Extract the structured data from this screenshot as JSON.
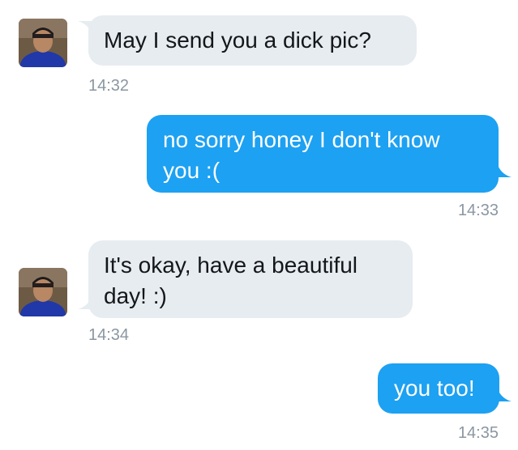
{
  "colors": {
    "incoming_bubble": "#e6ecf0",
    "outgoing_bubble": "#1da1f2",
    "timestamp": "#8a97a2"
  },
  "messages": [
    {
      "direction": "incoming",
      "text": "May I send you a dick pic?",
      "time": "14:32",
      "avatar_icon": "user-avatar"
    },
    {
      "direction": "outgoing",
      "text": "no sorry honey I don't know you :(",
      "time": "14:33"
    },
    {
      "direction": "incoming",
      "text": "It's okay, have a beautiful day! :)",
      "time": "14:34",
      "avatar_icon": "user-avatar"
    },
    {
      "direction": "outgoing",
      "text": "you too!",
      "time": "14:35"
    }
  ]
}
